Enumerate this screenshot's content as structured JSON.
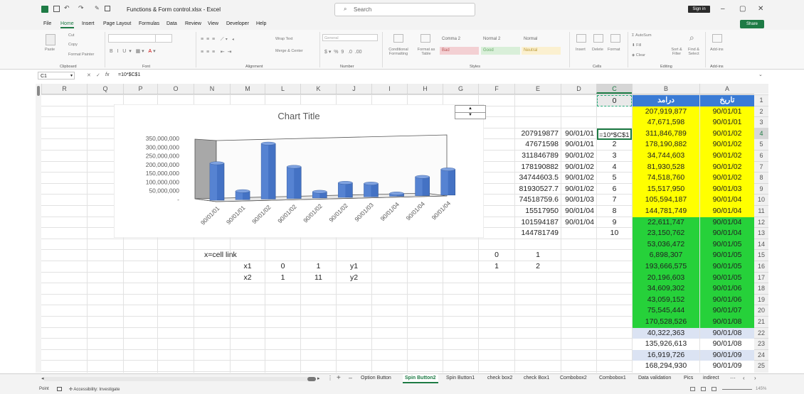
{
  "window": {
    "title": "Functions & Form control.xlsx  -  Excel",
    "search_placeholder": "Search",
    "signin_label": "Sign in",
    "share_label": "Share"
  },
  "menu": [
    "File",
    "Home",
    "Insert",
    "Page Layout",
    "Formulas",
    "Data",
    "Review",
    "View",
    "Developer",
    "Help"
  ],
  "ribbon": {
    "clipboard": {
      "paste": "Paste",
      "cut": "Cut",
      "copy": "Copy",
      "format_painter": "Format Painter",
      "label": "Clipboard"
    },
    "font": {
      "label": "Font"
    },
    "alignment": {
      "wrap": "Wrap Text",
      "merge": "Merge & Center",
      "label": "Alignment"
    },
    "number": {
      "format": "General",
      "label": "Number"
    },
    "styles": {
      "conditional": "Conditional Formatting",
      "format_table": "Format as Table",
      "comma2": "Comma 2",
      "normal2": "Normal 2",
      "normal": "Normal",
      "bad": "Bad",
      "good": "Good",
      "neutral": "Neutral",
      "label": "Styles"
    },
    "cells": {
      "insert": "Insert",
      "delete": "Delete",
      "format": "Format",
      "label": "Cells"
    },
    "editing": {
      "autosum": "AutoSum",
      "fill": "Fill",
      "clear": "Clear",
      "sort": "Sort & Filter",
      "find": "Find & Select",
      "label": "Editing"
    },
    "addins": {
      "btn": "Add-ins",
      "label": "Add-ins"
    }
  },
  "formula_bar": {
    "name_box": "C1",
    "fx": "fx",
    "formula": "=10*$C$1"
  },
  "columns": [
    "R",
    "Q",
    "P",
    "O",
    "N",
    "M",
    "L",
    "K",
    "J",
    "I",
    "H",
    "G",
    "F",
    "E",
    "D",
    "C",
    "B",
    "A"
  ],
  "rows": [
    "1",
    "2",
    "3",
    "4",
    "5",
    "6",
    "7",
    "8",
    "9",
    "10",
    "11",
    "12",
    "13",
    "14",
    "15",
    "16",
    "17",
    "18",
    "19",
    "20",
    "21",
    "22",
    "23",
    "24",
    "25"
  ],
  "col_b_header": "درامد",
  "col_a_header": "تاریخ",
  "col_b": [
    "207,919,877",
    "47,671,598",
    "311,846,789",
    "178,190,882",
    "34,744,603",
    "81,930,528",
    "74,518,760",
    "15,517,950",
    "105,594,187",
    "144,781,749",
    "22,611,747",
    "23,150,762",
    "53,036,472",
    "6,898,307",
    "193,666,575",
    "20,196,603",
    "34,609,302",
    "43,059,152",
    "75,545,444",
    "170,528,526",
    "40,322,363",
    "135,926,613",
    "16,919,726",
    "168,294,930"
  ],
  "col_a": [
    "90/01/01",
    "90/01/01",
    "90/01/02",
    "90/01/02",
    "90/01/02",
    "90/01/02",
    "90/01/02",
    "90/01/03",
    "90/01/04",
    "90/01/04",
    "90/01/04",
    "90/01/04",
    "90/01/05",
    "90/01/05",
    "90/01/05",
    "90/01/05",
    "90/01/06",
    "90/01/06",
    "90/01/07",
    "90/01/08",
    "90/01/08",
    "90/01/08",
    "90/01/09",
    "90/01/09"
  ],
  "col_c": [
    "0",
    "",
    "",
    "=10*$C$1",
    "2",
    "3",
    "4",
    "5",
    "6",
    "7",
    "8",
    "9",
    "10"
  ],
  "col_d": [
    "90/01/01",
    "90/01/01",
    "90/01/02",
    "90/01/02",
    "90/01/02",
    "90/01/02",
    "90/01/03",
    "90/01/04",
    "90/01/04"
  ],
  "col_e": [
    "207919877",
    "47671598",
    "311846789",
    "178190882",
    "34744603.5",
    "81930527.7",
    "74518759.6",
    "15517950",
    "101594187",
    "144781749"
  ],
  "helper": {
    "n15": "x=cell link",
    "m16": "x1",
    "l16": "0",
    "k16": "1",
    "j16": "y1",
    "m17": "x2",
    "l17": "1",
    "k17": "11",
    "j17": "y2",
    "f15": "0",
    "e15": "1",
    "f16": "1",
    "e16": "2"
  },
  "tabs": [
    "Option Button",
    "Spin Button2",
    "Spin Button1",
    "check box2",
    "check Box1",
    "Combobox2",
    "Combobox1",
    "Data validation",
    "Pics",
    "indirect"
  ],
  "active_tab": "Spin Button2",
  "status": {
    "mode": "Point",
    "accessibility": "Accessibility: Investigate",
    "zoom": "145%"
  },
  "colors": {
    "yellow": "#ffff00",
    "green": "#26d13a",
    "blue_header": "#3a7bd5",
    "light_blue": "#dbe3f3",
    "bar": "#4472c4"
  },
  "chart_data": {
    "type": "bar",
    "title": "Chart Title",
    "categories": [
      "90/01/01",
      "90/01/01",
      "90/01/02",
      "90/01/02",
      "90/01/02",
      "90/01/02",
      "90/01/03",
      "90/01/04",
      "90/01/04",
      "90/01/04"
    ],
    "values": [
      207919877,
      47671598,
      311846789,
      178190882,
      34744603,
      81930528,
      74518760,
      15517950,
      105594187,
      144781749
    ],
    "yticks": [
      "350,000,000",
      "300,000,000",
      "250,000,000",
      "200,000,000",
      "150,000,000",
      "100,000,000",
      "50,000,000",
      "-"
    ],
    "ylim": [
      0,
      350000000
    ],
    "grid": false,
    "legend": "none"
  }
}
